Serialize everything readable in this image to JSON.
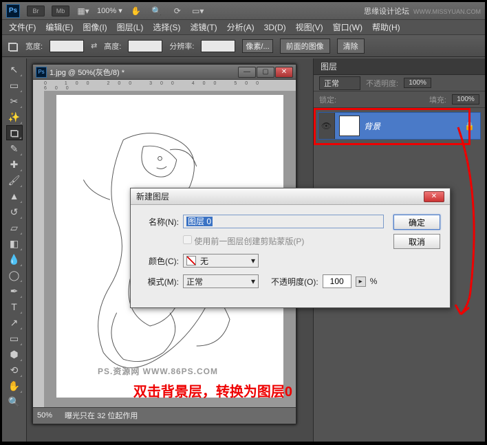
{
  "header": {
    "title": "思缘设计论坛",
    "url": "WWW.MISSYUAN.COM",
    "zoom": "100% ▾"
  },
  "menu": [
    "文件(F)",
    "编辑(E)",
    "图像(I)",
    "图层(L)",
    "选择(S)",
    "滤镜(T)",
    "分析(A)",
    "3D(D)",
    "视图(V)",
    "窗口(W)",
    "帮助(H)"
  ],
  "options": {
    "width_label": "宽度:",
    "height_label": "高度:",
    "res_label": "分辨率:",
    "unit": "像素/...",
    "front_img": "前面的图像",
    "clear": "清除"
  },
  "doc": {
    "title": "1.jpg @ 50%(灰色/8) *",
    "zoom": "50%",
    "status": "曝光只在 32 位起作用",
    "watermark": "PS.资源网   WWW.86PS.COM"
  },
  "layers": {
    "tab": "图层",
    "blend": "正常",
    "opacity_label": "不透明度:",
    "opacity_val": "100%",
    "fill_label": "填充:",
    "fill_val": "100%",
    "lock_label": "锁定:",
    "bg_name": "背景"
  },
  "dialog": {
    "title": "新建图层",
    "name_label": "名称(N):",
    "name_value": "图层 0",
    "clip_label": "使用前一图层创建剪贴蒙版(P)",
    "color_label": "颜色(C):",
    "color_value": "无",
    "mode_label": "模式(M):",
    "mode_value": "正常",
    "opacity_label": "不透明度(O):",
    "opacity_value": "100",
    "ok": "确定",
    "cancel": "取消"
  },
  "note": "双击背景层，转换为图层0"
}
